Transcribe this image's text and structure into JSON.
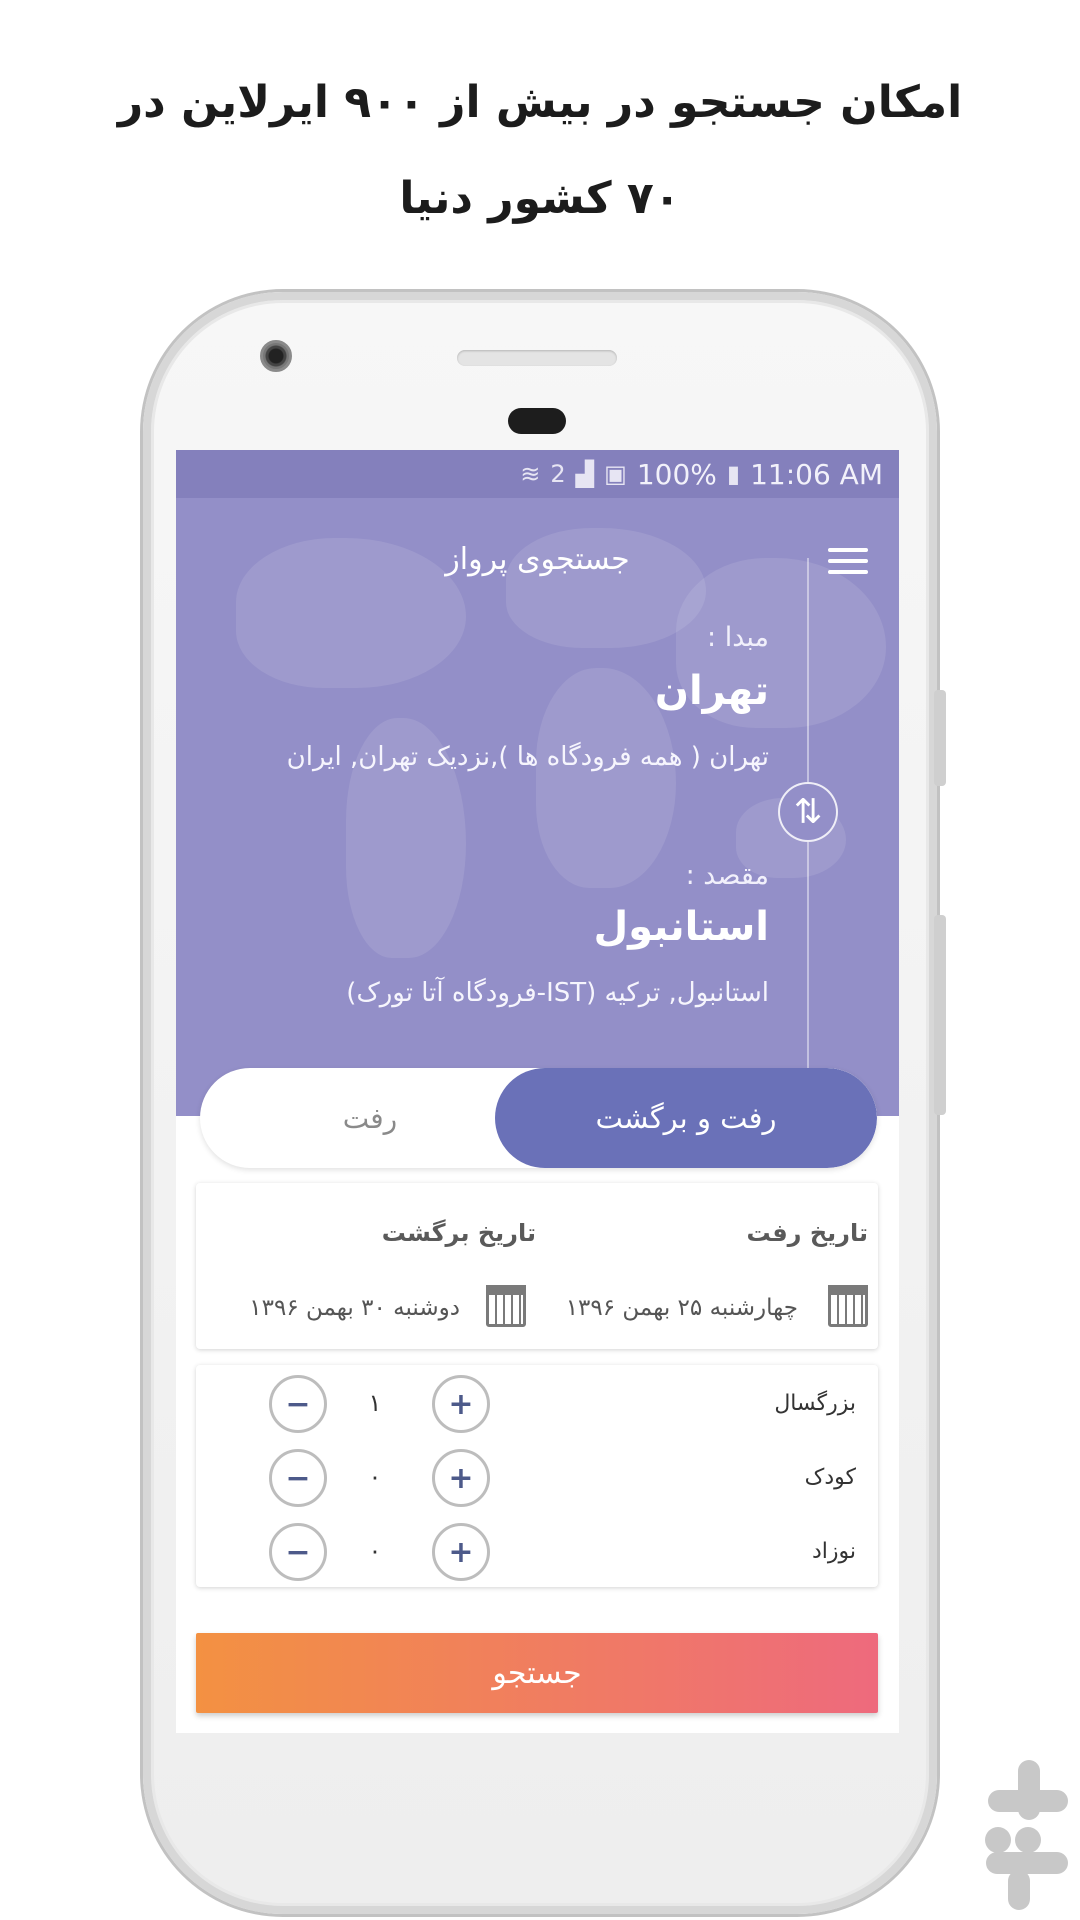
{
  "promo": {
    "line1": "امکان جستجو در بیش از ۹۰۰ ایرلاین در",
    "line2": "۷۰ کشور دنیا"
  },
  "statusbar": {
    "battery": "100%",
    "time": "11:06 AM",
    "sim": "2"
  },
  "appbar": {
    "title": "جستجوی پرواز"
  },
  "origin": {
    "label": "مبدا :",
    "city": "تهران",
    "detail": "تهران ( همه فرودگاه ها ),نزدیک تهران, ایران"
  },
  "destination": {
    "label": "مقصد :",
    "city": "استانبول",
    "detail": "استانبول, ترکیه (IST-فرودگاه آتا تورک)"
  },
  "trip_type": {
    "round_trip": "رفت و برگشت",
    "one_way": "رفت"
  },
  "dates": {
    "depart_label": "تاریخ رفت",
    "depart_value": "چهارشنبه ۲۵ بهمن ۱۳۹۶",
    "return_label": "تاریخ برگشت",
    "return_value": "دوشنبه ۳۰ بهمن ۱۳۹۶"
  },
  "passengers": [
    {
      "label": "بزرگسال",
      "count": "۱"
    },
    {
      "label": "کودک",
      "count": "۰"
    },
    {
      "label": "نوزاد",
      "count": "۰"
    }
  ],
  "stepper": {
    "plus": "+",
    "minus": "−"
  },
  "search": {
    "label": "جستجو"
  },
  "colors": {
    "hero": "#938fc8",
    "toggle_active": "#6a71b8",
    "search_start": "#f39142",
    "search_end": "#ee6a7d"
  }
}
